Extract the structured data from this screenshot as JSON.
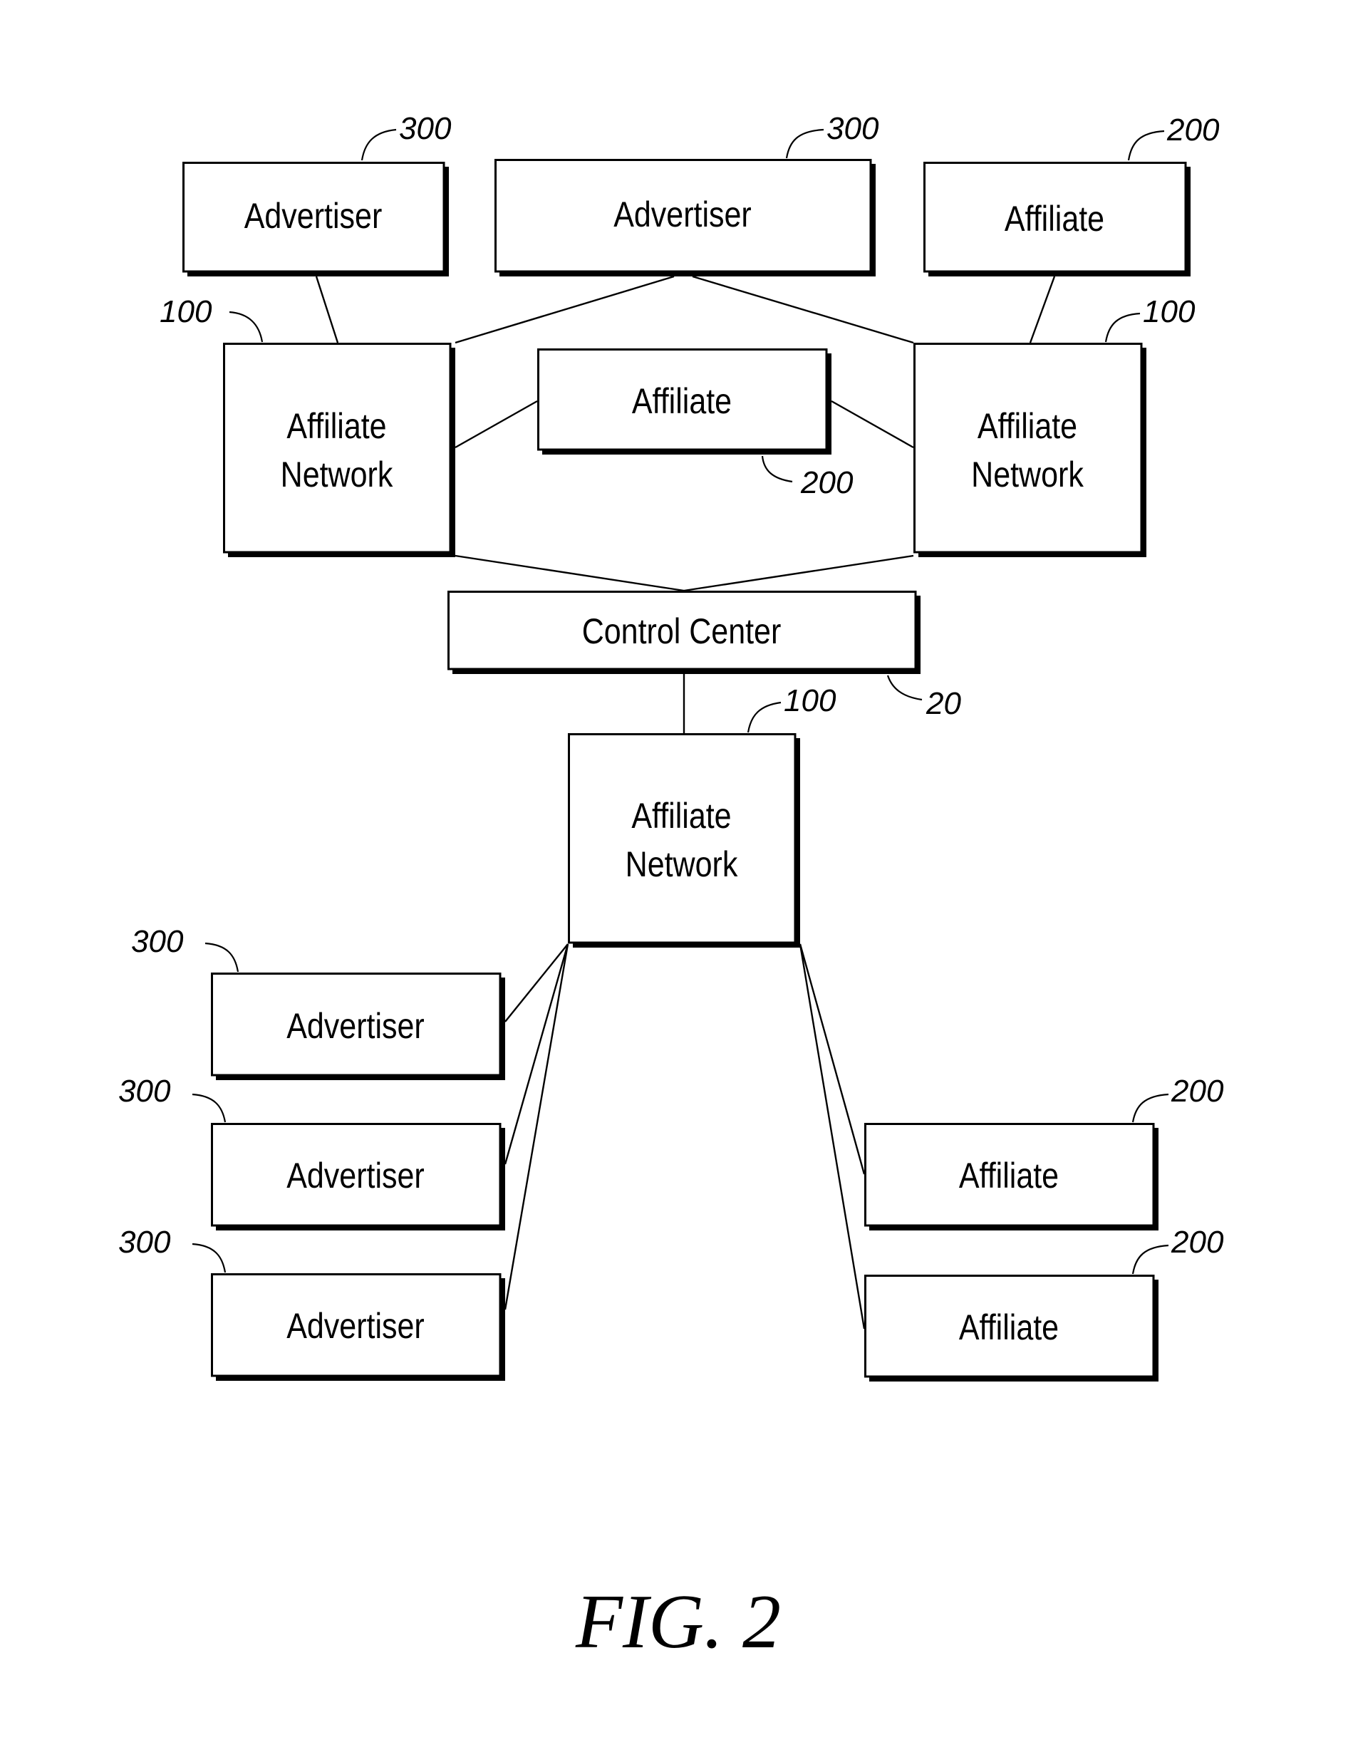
{
  "figure": {
    "caption": "FIG. 2",
    "nodes": [
      {
        "id": "adv_top_left",
        "label": [
          "Advertiser"
        ],
        "ref": "300"
      },
      {
        "id": "adv_top_center",
        "label": [
          "Advertiser"
        ],
        "ref": "300"
      },
      {
        "id": "aff_top_right",
        "label": [
          "Affiliate"
        ],
        "ref": "200"
      },
      {
        "id": "an_left",
        "label": [
          "Affiliate",
          "Network"
        ],
        "ref": "100"
      },
      {
        "id": "aff_middle",
        "label": [
          "Affiliate"
        ],
        "ref": "200"
      },
      {
        "id": "an_right",
        "label": [
          "Affiliate",
          "Network"
        ],
        "ref": "100"
      },
      {
        "id": "control_center",
        "label": [
          "Control Center"
        ],
        "ref": "20"
      },
      {
        "id": "an_bottom",
        "label": [
          "Affiliate",
          "Network"
        ],
        "ref": "100"
      },
      {
        "id": "adv_bottom_1",
        "label": [
          "Advertiser"
        ],
        "ref": "300"
      },
      {
        "id": "adv_bottom_2",
        "label": [
          "Advertiser"
        ],
        "ref": "300"
      },
      {
        "id": "adv_bottom_3",
        "label": [
          "Advertiser"
        ],
        "ref": "300"
      },
      {
        "id": "aff_bottom_1",
        "label": [
          "Affiliate"
        ],
        "ref": "200"
      },
      {
        "id": "aff_bottom_2",
        "label": [
          "Affiliate"
        ],
        "ref": "200"
      }
    ],
    "edges": [
      [
        "adv_top_left",
        "an_left"
      ],
      [
        "adv_top_center",
        "an_left"
      ],
      [
        "adv_top_center",
        "an_right"
      ],
      [
        "aff_top_right",
        "an_right"
      ],
      [
        "an_left",
        "aff_middle"
      ],
      [
        "aff_middle",
        "an_right"
      ],
      [
        "an_left",
        "control_center"
      ],
      [
        "an_right",
        "control_center"
      ],
      [
        "control_center",
        "an_bottom"
      ],
      [
        "an_bottom",
        "adv_bottom_1"
      ],
      [
        "an_bottom",
        "adv_bottom_2"
      ],
      [
        "an_bottom",
        "adv_bottom_3"
      ],
      [
        "an_bottom",
        "aff_bottom_1"
      ],
      [
        "an_bottom",
        "aff_bottom_2"
      ]
    ]
  }
}
